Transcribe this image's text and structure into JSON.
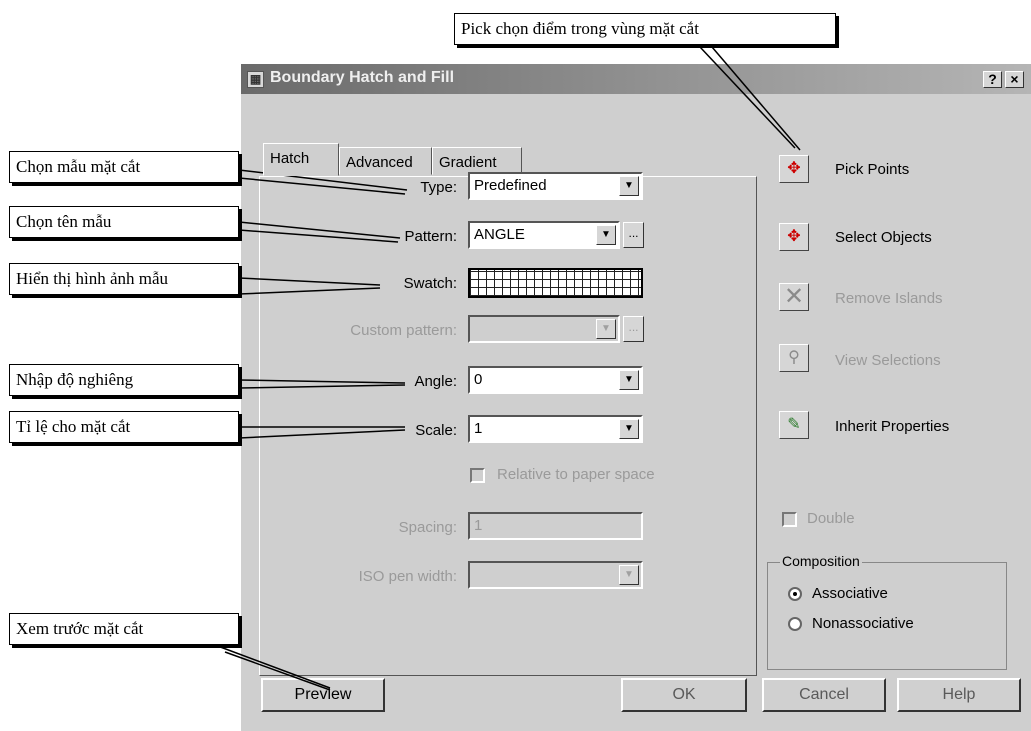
{
  "dialog": {
    "title": "Boundary Hatch and Fill",
    "help_btn": "?",
    "close_btn": "×",
    "tabs": [
      "Hatch",
      "Advanced",
      "Gradient"
    ],
    "type": {
      "label": "Type:",
      "value": "Predefined"
    },
    "pattern": {
      "label": "Pattern:",
      "value": "ANGLE"
    },
    "swatch": {
      "label": "Swatch:"
    },
    "custom_pattern": {
      "label": "Custom pattern:",
      "value": ""
    },
    "angle": {
      "label": "Angle:",
      "value": "0"
    },
    "scale": {
      "label": "Scale:",
      "value": "1"
    },
    "relative": {
      "label": "Relative to paper space",
      "checked": false
    },
    "spacing": {
      "label": "Spacing:",
      "value": "1"
    },
    "iso": {
      "label": "ISO pen width:",
      "value": ""
    },
    "right_buttons": [
      {
        "label": "Pick Points",
        "icon": "pick-points-icon"
      },
      {
        "label": "Select Objects",
        "icon": "select-objects-icon"
      },
      {
        "label": "Remove Islands",
        "icon": "remove-islands-icon"
      },
      {
        "label": "View Selections",
        "icon": "view-selections-icon"
      },
      {
        "label": "Inherit Properties",
        "icon": "inherit-properties-icon"
      }
    ],
    "double": {
      "label": "Double",
      "checked": false
    },
    "composition": {
      "title": "Composition",
      "options": [
        "Associative",
        "Nonassociative"
      ],
      "selected": "Associative"
    },
    "buttons": {
      "preview": "Preview",
      "ok": "OK",
      "cancel": "Cancel",
      "help": "Help"
    }
  },
  "callouts": {
    "pick": "Pick chọn điểm trong vùng mặt cắt",
    "type": "Chọn mẫu mặt cắt",
    "pattern": "Chọn tên mẫu",
    "swatch": "Hiển thị hình ảnh mẫu",
    "angle": "Nhập độ nghiêng",
    "scale": "Tỉ lệ cho mặt cắt",
    "preview": "Xem trước mặt cắt"
  }
}
